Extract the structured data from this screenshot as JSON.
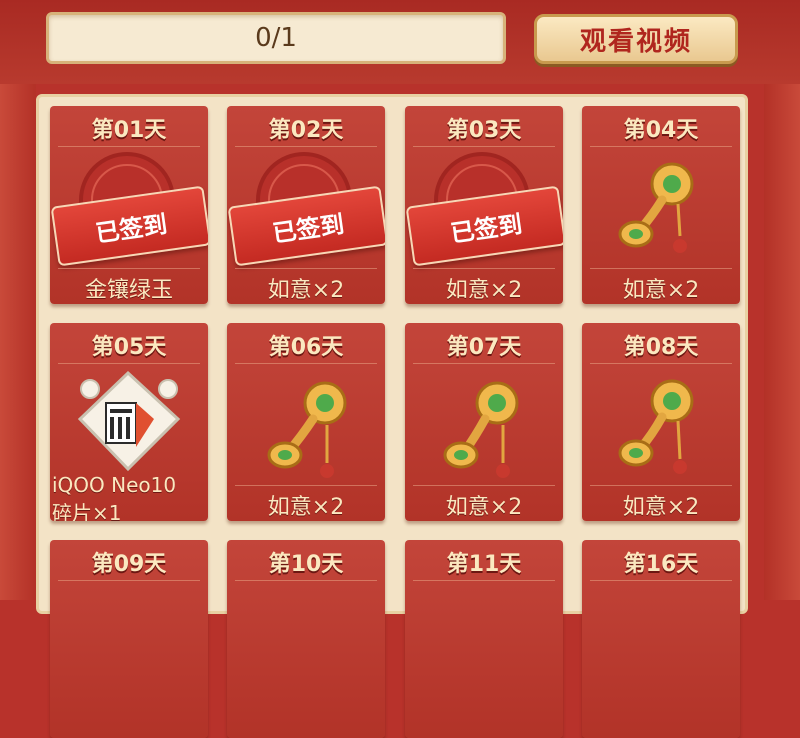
{
  "header": {
    "progress": "0/1",
    "watch_video_label": "观看视频"
  },
  "days": [
    {
      "title": "第01天",
      "reward": "金镶绿玉",
      "signed": true,
      "stamp": "已签到"
    },
    {
      "title": "第02天",
      "reward": "如意×2",
      "signed": true,
      "stamp": "已签到"
    },
    {
      "title": "第03天",
      "reward": "如意×2",
      "signed": true,
      "stamp": "已签到"
    },
    {
      "title": "第04天",
      "reward": "如意×2",
      "signed": false
    },
    {
      "title": "第05天",
      "reward_line1": "iQOO Neo10",
      "reward_line2": "碎片×1",
      "signed": false
    },
    {
      "title": "第06天",
      "reward": "如意×2",
      "signed": false
    },
    {
      "title": "第07天",
      "reward": "如意×2",
      "signed": false
    },
    {
      "title": "第08天",
      "reward": "如意×2",
      "signed": false
    },
    {
      "title": "第09天",
      "signed": false
    },
    {
      "title": "第10天",
      "signed": false
    },
    {
      "title": "第11天",
      "signed": false
    },
    {
      "title": "第16天",
      "signed": false
    }
  ],
  "icons": {
    "ruyi": "ruyi-scepter-icon",
    "fragment": "phone-fragment-icon",
    "seal": "jade-seal-icon"
  },
  "colors": {
    "card_red": "#b23328",
    "gold_text": "#fbe8c0",
    "panel_cream": "#f3e3c6",
    "button_text": "#b0261e"
  }
}
